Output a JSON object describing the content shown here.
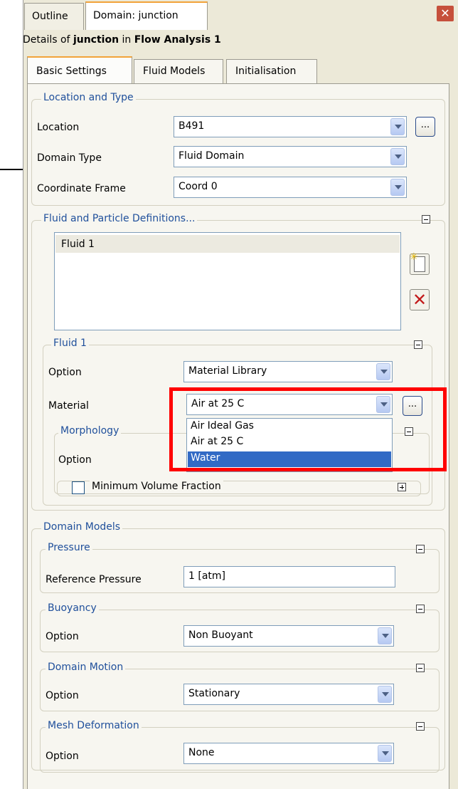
{
  "tabs": {
    "outline": "Outline",
    "domain": "Domain: junction"
  },
  "details": {
    "prefix": "Details of ",
    "object": "junction",
    "middle": " in ",
    "analysis": "Flow Analysis 1"
  },
  "subtabs": {
    "basic": "Basic Settings",
    "fluid_models": "Fluid Models",
    "initialisation": "Initialisation"
  },
  "location_and_type": {
    "title": "Location and Type",
    "location": {
      "label": "Location",
      "value": "B491",
      "browse": "..."
    },
    "domain_type": {
      "label": "Domain Type",
      "value": "Fluid Domain"
    },
    "coordinate_frame": {
      "label": "Coordinate Frame",
      "value": "Coord 0"
    }
  },
  "fluid_definitions": {
    "title": "Fluid and Particle Definitions...",
    "items": [
      "Fluid 1"
    ]
  },
  "fluid1": {
    "title": "Fluid 1",
    "option": {
      "label": "Option",
      "value": "Material Library"
    },
    "material": {
      "label": "Material",
      "value": "Air at 25 C",
      "browse": "...",
      "options": [
        "Air Ideal Gas",
        "Air at 25 C",
        "Water"
      ],
      "highlighted": "Water"
    },
    "morphology": {
      "title": "Morphology",
      "option_label": "Option"
    },
    "min_volume_fraction": {
      "label": "Minimum Volume Fraction",
      "checked": false
    }
  },
  "domain_models": {
    "title": "Domain Models",
    "pressure": {
      "title": "Pressure",
      "label": "Reference Pressure",
      "value": "1 [atm]"
    },
    "buoyancy": {
      "title": "Buoyancy",
      "label": "Option",
      "value": "Non Buoyant"
    },
    "domain_motion": {
      "title": "Domain Motion",
      "label": "Option",
      "value": "Stationary"
    },
    "mesh_deformation": {
      "title": "Mesh Deformation",
      "label": "Option",
      "value": "None"
    }
  },
  "colors": {
    "group_title": "#1f4f9b",
    "highlight": "#316ac5",
    "annotation": "#ff0000",
    "tab_accent": "#f2a33a"
  }
}
